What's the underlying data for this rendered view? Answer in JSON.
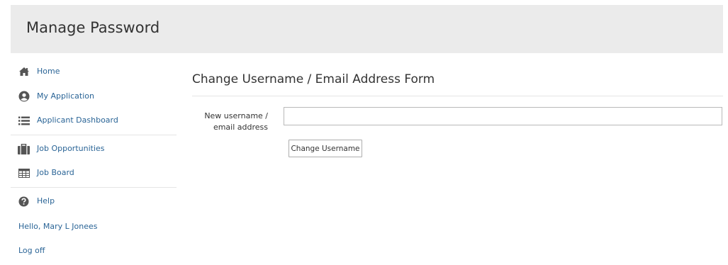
{
  "header": {
    "title": "Manage Password"
  },
  "sidebar": {
    "items": [
      {
        "label": "Home",
        "icon": "home-icon"
      },
      {
        "label": "My Application",
        "icon": "user-circle-icon"
      },
      {
        "label": "Applicant Dashboard",
        "icon": "list-icon"
      },
      {
        "label": "Job Opportunities",
        "icon": "briefcase-icon"
      },
      {
        "label": "Job Board",
        "icon": "table-icon"
      },
      {
        "label": "Help",
        "icon": "question-circle-icon"
      }
    ],
    "greeting": "Hello, Mary L Jonees",
    "logoff": "Log off"
  },
  "main": {
    "form_title": "Change Username / Email Address Form",
    "field_label_line1": "New username /",
    "field_label_line2": "email address",
    "field_value": "",
    "submit_label": "Change Username"
  },
  "colors": {
    "link": "#2a6496",
    "header_bg": "#ebebeb",
    "icon": "#555555"
  }
}
